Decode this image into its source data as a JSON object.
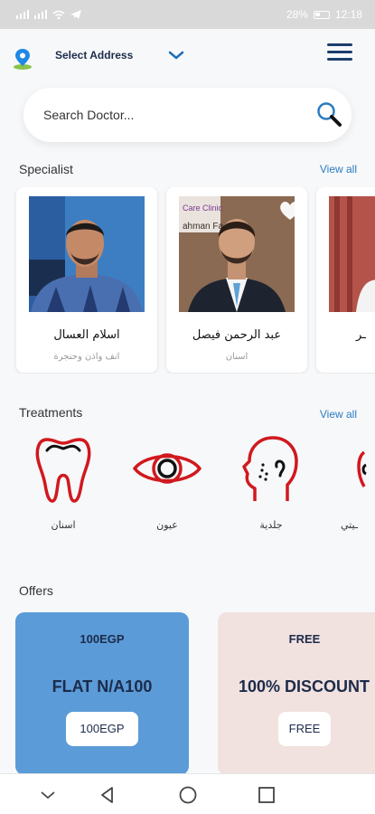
{
  "status": {
    "left_text": "ــــ",
    "battery": "28%",
    "time": "12:18"
  },
  "header": {
    "address_label": "Select Address"
  },
  "search": {
    "placeholder": "Search Doctor..."
  },
  "specialist": {
    "title": "Specialist",
    "view_all": "View all",
    "doctors": [
      {
        "name": "اسلام العسال",
        "specialty": "انف واذن وحنجرة"
      },
      {
        "name": "عبد الرحمن فيصل",
        "specialty": "اسنان",
        "clinic_sign": "Care Clinic",
        "clinic_sign2": "ahman Fa"
      },
      {
        "name": "ـر",
        "specialty": ""
      }
    ]
  },
  "treatments": {
    "title": "Treatments",
    "view_all": "View all",
    "items": [
      {
        "label": "اسنان",
        "icon": "tooth-icon"
      },
      {
        "label": "عيون",
        "icon": "eye-icon"
      },
      {
        "label": "جلدية",
        "icon": "face-skin-icon"
      },
      {
        "label": "ـيتي",
        "icon": "partial-icon"
      }
    ]
  },
  "offers": {
    "title": "Offers",
    "items": [
      {
        "top": "100EGP",
        "main": "FLAT N/A100",
        "button": "100EGP",
        "color": "#5b9bd8"
      },
      {
        "top": "FREE",
        "main": "100% DISCOUNT",
        "button": "FREE",
        "color": "#f1e1df"
      }
    ]
  },
  "colors": {
    "accent": "#2a7bbf",
    "icon_red": "#d0191e",
    "navy": "#1c2b4a"
  }
}
